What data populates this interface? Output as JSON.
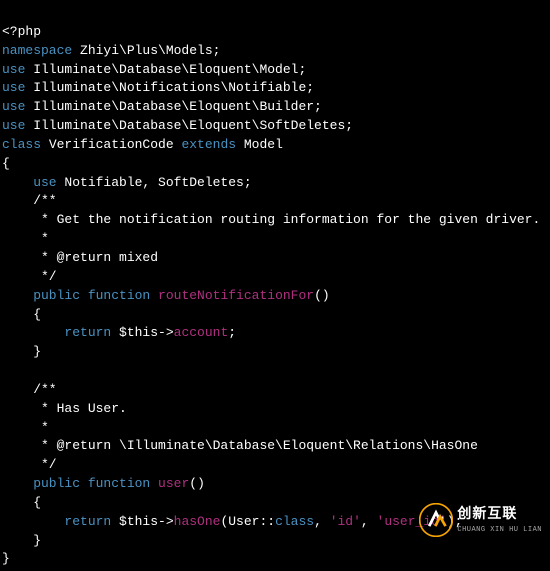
{
  "code": {
    "l1_open": "<?php",
    "l2_ns": "namespace",
    "l2_ns_val": " Zhiyi\\Plus\\Models;",
    "l3_use": "use",
    "l3_val": " Illuminate\\Database\\Eloquent\\Model;",
    "l4_use": "use",
    "l4_val": " Illuminate\\Notifications\\Notifiable;",
    "l5_use": "use",
    "l5_val": " Illuminate\\Database\\Eloquent\\Builder;",
    "l6_use": "use",
    "l6_val": " Illuminate\\Database\\Eloquent\\SoftDeletes;",
    "l7_class": "class",
    "l7_name": " VerificationCode ",
    "l7_ext": "extends",
    "l7_model": " Model",
    "l8": "{",
    "l9_use": "    use",
    "l9_traits": " Notifiable, SoftDeletes;",
    "l10": "    /**",
    "l11": "     * Get the notification routing information for the given driver.",
    "l12": "     *",
    "l13": "     * @return mixed",
    "l14": "     */",
    "l15_pub": "    public ",
    "l15_func": "function ",
    "l15_name": "routeNotificationFor",
    "l15_paren": "()",
    "l16": "    {",
    "l17_ret": "        return",
    "l17_this": " $this->",
    "l17_prop": "account",
    "l17_semi": ";",
    "l18": "    }",
    "l19": "",
    "l20": "    /**",
    "l21": "     * Has User.",
    "l22": "     *",
    "l23": "     * @return \\Illuminate\\Database\\Eloquent\\Relations\\HasOne",
    "l24": "     */",
    "l25_pub": "    public ",
    "l25_func": "function ",
    "l25_name": "user",
    "l25_paren": "()",
    "l26": "    {",
    "l27_ret": "        return",
    "l27_this": " $this->",
    "l27_method": "hasOne",
    "l27_open": "(User::",
    "l27_class": "class",
    "l27_mid": ", ",
    "l27_a1": "'id'",
    "l27_mid2": ", ",
    "l27_a2": "'user_id'",
    "l27_close": ");",
    "l28": "    }",
    "l29": "}"
  },
  "logo": {
    "cn": "创新互联",
    "en": "CHUANG XIN HU LIAN"
  }
}
